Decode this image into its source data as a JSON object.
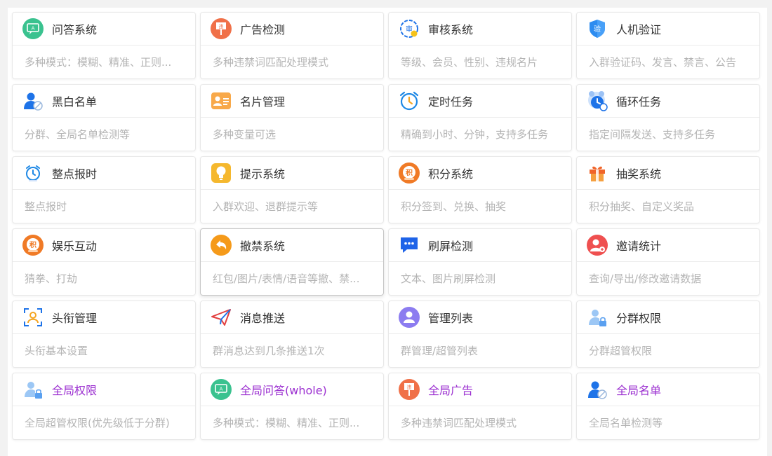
{
  "cards": [
    {
      "title": "问答系统",
      "desc": "多种模式：模糊、精准、正则...",
      "icon": "qa-chat-icon",
      "accent": "#3ac28f"
    },
    {
      "title": "广告检测",
      "desc": "多种违禁词匹配处理模式",
      "icon": "ad-sign-icon",
      "accent": "#f07048"
    },
    {
      "title": "审核系统",
      "desc": "等级、会员、性别、违规名片",
      "icon": "audit-stamp-icon",
      "accent": "#1e73e8"
    },
    {
      "title": "人机验证",
      "desc": "入群验证码、发言、禁言、公告",
      "icon": "shield-verify-icon",
      "accent": "#2d8cf0"
    },
    {
      "title": "黑白名单",
      "desc": "分群、全局名单检测等",
      "icon": "user-block-icon",
      "accent": "#1e73e8"
    },
    {
      "title": "名片管理",
      "desc": "多种变量可选",
      "icon": "business-card-icon",
      "accent": "#f8a94a"
    },
    {
      "title": "定时任务",
      "desc": "精确到小时、分钟，支持多任务",
      "icon": "alarm-clock-icon",
      "accent": "#1e88e5"
    },
    {
      "title": "循环任务",
      "desc": "指定间隔发送、支持多任务",
      "icon": "loop-clock-icon",
      "accent": "#1e73e8"
    },
    {
      "title": "整点报时",
      "desc": "整点报时",
      "icon": "clock-chime-icon",
      "accent": "#1e88e5"
    },
    {
      "title": "提示系统",
      "desc": "入群欢迎、退群提示等",
      "icon": "lightbulb-icon",
      "accent": "#f5b82e"
    },
    {
      "title": "积分系统",
      "desc": "积分签到、兑换、抽奖",
      "icon": "points-badge-icon",
      "accent": "#f07a26"
    },
    {
      "title": "抽奖系统",
      "desc": "积分抽奖、自定义奖品",
      "icon": "gift-box-icon",
      "accent": "#f0652a"
    },
    {
      "title": "娱乐互动",
      "desc": "猜拳、打劫",
      "icon": "points-badge-icon",
      "accent": "#f07a26"
    },
    {
      "title": "撤禁系统",
      "desc": "红包/图片/表情/语音等撤、禁...",
      "icon": "undo-arrow-icon",
      "accent": "#f59a1a"
    },
    {
      "title": "刷屏检测",
      "desc": "文本、图片刷屏检测",
      "icon": "chat-bubble-icon",
      "accent": "#1e63e8"
    },
    {
      "title": "邀请统计",
      "desc": "查询/导出/修改邀请数据",
      "icon": "user-add-icon",
      "accent": "#ef5050"
    },
    {
      "title": "头衔管理",
      "desc": "头衔基本设置",
      "icon": "user-frame-icon",
      "accent": "#f5a623"
    },
    {
      "title": "消息推送",
      "desc": "群消息达到几条推送1次",
      "icon": "paper-plane-icon",
      "accent": "#e24040"
    },
    {
      "title": "管理列表",
      "desc": "群管理/超管列表",
      "icon": "admin-list-icon",
      "accent": "#8c7cf0"
    },
    {
      "title": "分群权限",
      "desc": "分群超管权限",
      "icon": "user-lock-icon",
      "accent": "#5aa0f0"
    },
    {
      "title": "全局权限",
      "desc": "全局超管权限(优先级低于分群)",
      "icon": "user-lock-icon",
      "accent": "#5aa0f0",
      "purple": true
    },
    {
      "title": "全局问答(whole)",
      "desc": "多种模式：模糊、精准、正则...",
      "icon": "qa-chat-icon",
      "accent": "#3ac28f",
      "purple": true
    },
    {
      "title": "全局广告",
      "desc": "多种违禁词匹配处理模式",
      "icon": "ad-sign-icon",
      "accent": "#f07048",
      "purple": true
    },
    {
      "title": "全局名单",
      "desc": "全局名单检测等",
      "icon": "user-block-icon",
      "accent": "#1e73e8",
      "purple": true
    }
  ],
  "active_card_index": 13
}
